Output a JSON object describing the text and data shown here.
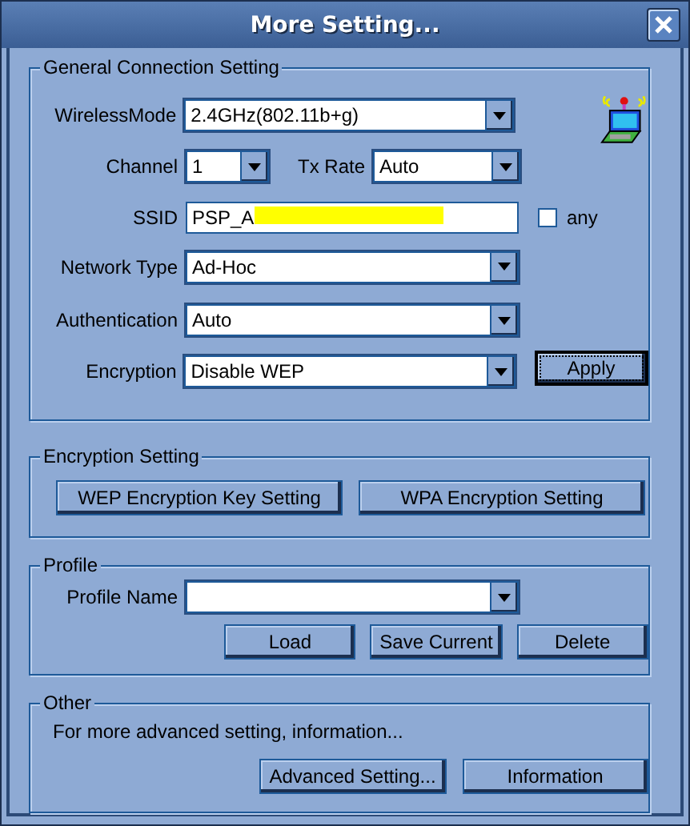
{
  "window": {
    "title": "More Setting..."
  },
  "general": {
    "legend": "General Connection Setting",
    "wireless_mode": {
      "label": "WirelessMode",
      "value": "2.4GHz(802.11b+g)"
    },
    "channel": {
      "label": "Channel",
      "value": "1"
    },
    "tx_rate": {
      "label": "Tx Rate",
      "value": "Auto"
    },
    "ssid": {
      "label": "SSID",
      "value": "PSP_A",
      "any": {
        "label": "any",
        "checked": false
      }
    },
    "network_type": {
      "label": "Network Type",
      "value": "Ad-Hoc"
    },
    "authentication": {
      "label": "Authentication",
      "value": "Auto"
    },
    "encryption": {
      "label": "Encryption",
      "value": "Disable WEP"
    },
    "apply": "Apply"
  },
  "encryption_setting": {
    "legend": "Encryption Setting",
    "buttons": [
      "WEP Encryption Key Setting",
      "WPA Encryption Setting"
    ]
  },
  "profile": {
    "legend": "Profile",
    "name_label": "Profile Name",
    "buttons": [
      "Load",
      "Save Current",
      "Delete"
    ]
  },
  "other": {
    "legend": "Other",
    "text": "For more advanced setting, information...",
    "buttons": [
      "Advanced Setting...",
      "Information"
    ]
  }
}
